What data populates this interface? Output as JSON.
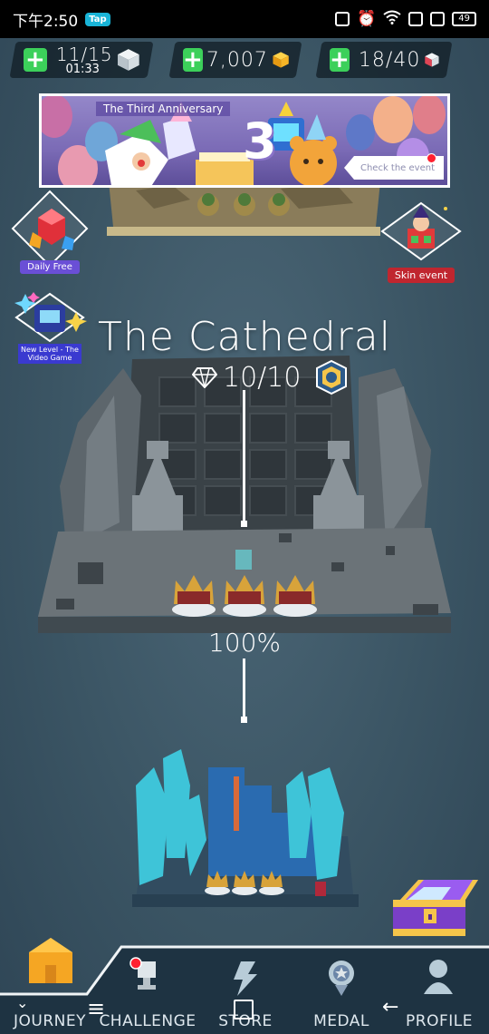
{
  "status_bar": {
    "time": "下午2:50",
    "tap_badge": "Tap",
    "battery": "49"
  },
  "resources": {
    "energy": {
      "value": "11/15",
      "timer": "01:33"
    },
    "gold": {
      "value": "7,007"
    },
    "gems": {
      "value": "18/40"
    }
  },
  "banner": {
    "title": "The Third Anniversary",
    "number": "3",
    "cta": "Check the event"
  },
  "side_events": {
    "daily_free": "Daily Free",
    "new_level": "New Level - The Video Game",
    "skin_event": "Skin event"
  },
  "level": {
    "title": "The Cathedral",
    "gems": "10/10",
    "percent": "100%"
  },
  "nav": {
    "journey": "JOURNEY",
    "challenge": "CHALLENGE",
    "store": "STORE",
    "medal": "MEDAL",
    "profile": "PROFILE"
  },
  "colors": {
    "background": "#3b5564",
    "accent_green": "#3cd05a",
    "journey_orange": "#f5a623",
    "badge_red": "#ff2030"
  }
}
